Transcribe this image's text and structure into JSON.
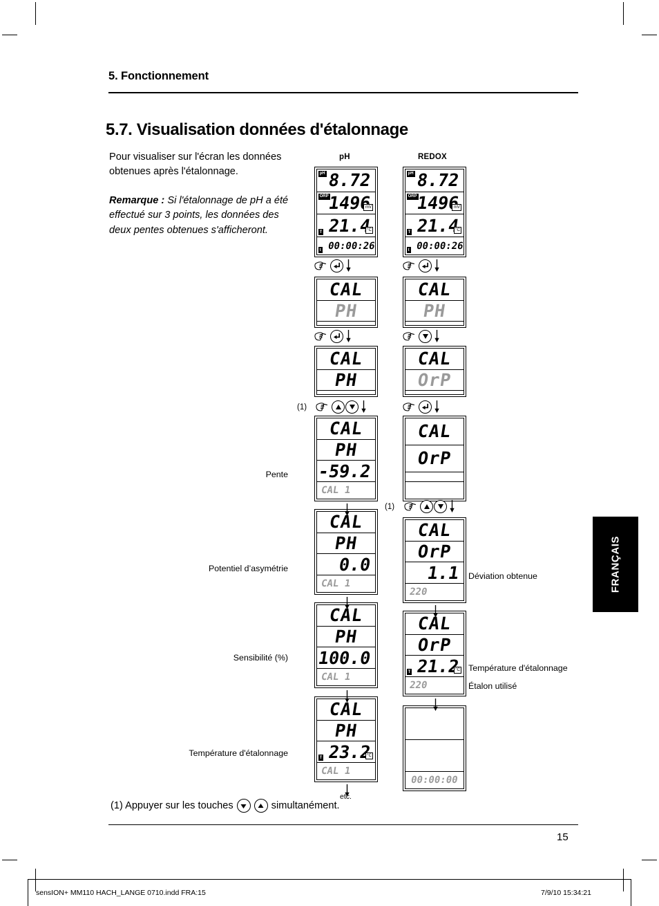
{
  "header": {
    "chapter": "5. Fonctionnement",
    "section": "5.7. Visualisation données d'étalonnage"
  },
  "intro": {
    "paragraph": "Pour visualiser sur l'écran les données obtenues après l'étalonnage.",
    "note_label": "Remarque :",
    "note_body": " Si l'étalonnage de pH a été effectué sur 3 points, les données des deux pentes obtenues s'afficheront."
  },
  "columns": {
    "left": "pH",
    "right": "REDOX"
  },
  "labels": {
    "pente": "Pente",
    "potentiel": "Potentiel d’asymétrie",
    "sensibilite": "Sensibilité (%)",
    "temperature": "Température d'étalonnage",
    "deviation": "Déviation obtenue",
    "temperature_r": "Température d'étalonnage",
    "etalon": "Étalon utilisé",
    "marker": "(1)",
    "etc": "etc."
  },
  "footnote": {
    "prefix": "(1) Appuyer sur les touches",
    "suffix": "simultanément."
  },
  "ph_flow": [
    {
      "rows": [
        {
          "badge": "pH",
          "value": "8.72",
          "unit": "",
          "size": "big",
          "grey": false
        },
        {
          "badge": "ORP",
          "value": "1496",
          "unit": "mV",
          "size": "big",
          "grey": false
        },
        {
          "badge": "T",
          "value": "21.4",
          "unit": "°C",
          "size": "big",
          "grey": false,
          "badge_pos": "bl"
        },
        {
          "badge": "t",
          "value": "00:00:26",
          "unit": "",
          "size": "small",
          "grey": false,
          "badge_pos": "bl",
          "align": "left"
        }
      ]
    },
    {
      "rows": [
        {
          "badge": "",
          "value": "CAL",
          "unit": "",
          "size": "word",
          "grey": false,
          "centre": true
        },
        {
          "badge": "",
          "value": "PH",
          "unit": "",
          "size": "word",
          "grey": true,
          "centre": true
        },
        {
          "badge": "",
          "value": "",
          "unit": "",
          "size": "word",
          "grey": false
        }
      ]
    },
    {
      "rows": [
        {
          "badge": "",
          "value": "CAL",
          "unit": "",
          "size": "word",
          "grey": false,
          "centre": true
        },
        {
          "badge": "",
          "value": "PH",
          "unit": "",
          "size": "word",
          "grey": false,
          "centre": true
        },
        {
          "badge": "",
          "value": "",
          "unit": "",
          "size": "word",
          "grey": false
        }
      ]
    },
    {
      "rows": [
        {
          "badge": "",
          "value": "CAL",
          "unit": "",
          "size": "word",
          "grey": false,
          "centre": true
        },
        {
          "badge": "",
          "value": "PH",
          "unit": "",
          "size": "word",
          "grey": false,
          "centre": true
        },
        {
          "badge": "",
          "value": "-59.2",
          "unit": "",
          "size": "mid",
          "grey": false
        },
        {
          "badge": "",
          "value": "CAL 1",
          "unit": "",
          "size": "small",
          "grey": true,
          "align": "left"
        }
      ]
    },
    {
      "rows": [
        {
          "badge": "",
          "value": "CAL",
          "unit": "",
          "size": "word",
          "grey": false,
          "centre": true
        },
        {
          "badge": "",
          "value": "PH",
          "unit": "",
          "size": "word",
          "grey": false,
          "centre": true
        },
        {
          "badge": "",
          "value": "0.0",
          "unit": "",
          "size": "mid",
          "grey": false
        },
        {
          "badge": "",
          "value": "CAL 1",
          "unit": "",
          "size": "small",
          "grey": true,
          "align": "left"
        }
      ]
    },
    {
      "rows": [
        {
          "badge": "",
          "value": "CAL",
          "unit": "",
          "size": "word",
          "grey": false,
          "centre": true
        },
        {
          "badge": "",
          "value": "PH",
          "unit": "",
          "size": "word",
          "grey": false,
          "centre": true
        },
        {
          "badge": "",
          "value": "100.0",
          "unit": "",
          "size": "mid",
          "grey": false
        },
        {
          "badge": "",
          "value": "CAL 1",
          "unit": "",
          "size": "small",
          "grey": true,
          "align": "left"
        }
      ]
    },
    {
      "rows": [
        {
          "badge": "",
          "value": "CAL",
          "unit": "",
          "size": "word",
          "grey": false,
          "centre": true
        },
        {
          "badge": "",
          "value": "PH",
          "unit": "",
          "size": "word",
          "grey": false,
          "centre": true
        },
        {
          "badge": "T",
          "value": "23.2",
          "unit": "°C",
          "size": "mid",
          "grey": false,
          "badge_pos": "bl"
        },
        {
          "badge": "",
          "value": "CAL 1",
          "unit": "",
          "size": "small",
          "grey": true,
          "align": "left"
        }
      ]
    }
  ],
  "redox_flow": [
    {
      "rows": [
        {
          "badge": "pH",
          "value": "8.72",
          "unit": "",
          "size": "big",
          "grey": false
        },
        {
          "badge": "ORP",
          "value": "1496",
          "unit": "mV",
          "size": "big",
          "grey": false
        },
        {
          "badge": "T",
          "value": "21.4",
          "unit": "°C",
          "size": "big",
          "grey": false,
          "badge_pos": "bl"
        },
        {
          "badge": "t",
          "value": "00:00:26",
          "unit": "",
          "size": "small",
          "grey": false,
          "badge_pos": "bl",
          "align": "left"
        }
      ]
    },
    {
      "rows": [
        {
          "badge": "",
          "value": "CAL",
          "unit": "",
          "size": "word",
          "grey": false,
          "centre": true
        },
        {
          "badge": "",
          "value": "PH",
          "unit": "",
          "size": "word",
          "grey": true,
          "centre": true
        },
        {
          "badge": "",
          "value": "",
          "unit": "",
          "size": "word",
          "grey": false
        }
      ]
    },
    {
      "rows": [
        {
          "badge": "",
          "value": "CAL",
          "unit": "",
          "size": "word",
          "grey": false,
          "centre": true
        },
        {
          "badge": "",
          "value": "OrP",
          "unit": "",
          "size": "word",
          "grey": true,
          "centre": true
        },
        {
          "badge": "",
          "value": "",
          "unit": "",
          "size": "word",
          "grey": false
        }
      ]
    },
    {
      "rows": [
        {
          "badge": "",
          "value": "CAL",
          "unit": "",
          "size": "word",
          "grey": false,
          "centre": true
        },
        {
          "badge": "",
          "value": "OrP",
          "unit": "",
          "size": "word",
          "grey": false,
          "centre": true
        },
        {
          "badge": "",
          "value": "",
          "unit": "",
          "size": "word",
          "grey": false
        },
        {
          "badge": "",
          "value": "",
          "unit": "",
          "size": "small",
          "grey": false
        }
      ]
    },
    {
      "rows": [
        {
          "badge": "",
          "value": "CAL",
          "unit": "",
          "size": "word",
          "grey": false,
          "centre": true
        },
        {
          "badge": "",
          "value": "OrP",
          "unit": "",
          "size": "word",
          "grey": false,
          "centre": true
        },
        {
          "badge": "",
          "value": "1.1",
          "unit": "",
          "size": "mid",
          "grey": false
        },
        {
          "badge": "",
          "value": "220",
          "unit": "",
          "size": "small",
          "grey": true,
          "align": "left"
        }
      ]
    },
    {
      "rows": [
        {
          "badge": "",
          "value": "CAL",
          "unit": "",
          "size": "word",
          "grey": false,
          "centre": true
        },
        {
          "badge": "",
          "value": "OrP",
          "unit": "",
          "size": "word",
          "grey": false,
          "centre": true
        },
        {
          "badge": "T",
          "value": "21.2",
          "unit": "°C",
          "size": "mid",
          "grey": false,
          "badge_pos": "bl"
        },
        {
          "badge": "",
          "value": "220",
          "unit": "",
          "size": "small",
          "grey": true,
          "align": "left"
        }
      ]
    },
    {
      "rows": [
        {
          "badge": "",
          "value": "",
          "unit": "",
          "size": "word",
          "grey": false
        },
        {
          "badge": "",
          "value": "",
          "unit": "",
          "size": "word",
          "grey": false
        },
        {
          "badge": "",
          "value": "00:00:00",
          "unit": "",
          "size": "small",
          "grey": true,
          "centre": true
        }
      ]
    }
  ],
  "imprint": {
    "left": "sensION+ MM110 HACH_LANGE 0710.indd   FRA:15",
    "right": "7/9/10   15:34:21"
  },
  "folio": "15",
  "tab": "FRANÇAIS"
}
